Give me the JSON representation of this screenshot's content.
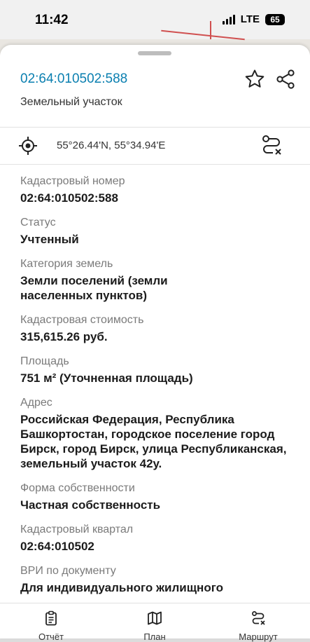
{
  "status_bar": {
    "time": "11:42",
    "network": "LTE",
    "battery": "65"
  },
  "header": {
    "cadastral_number": "02:64:010502:588",
    "object_type": "Земельный участок",
    "favorite_icon": "star-icon",
    "share_icon": "share-icon"
  },
  "location": {
    "coordinates": "55°26.44'N, 55°34.94'E",
    "locate_icon": "crosshair-icon",
    "route_icon": "route-icon"
  },
  "fields": [
    {
      "label": "Кадастровый номер",
      "value": "02:64:010502:588"
    },
    {
      "label": "Статус",
      "value": "Учтенный"
    },
    {
      "label": "Категория земель",
      "value": "Земли поселений (земли населенных пунктов)"
    },
    {
      "label": "Кадастровая стоимость",
      "value": "315,615.26 руб."
    },
    {
      "label": "Площадь",
      "value": "751 м² (Уточненная площадь)"
    },
    {
      "label": "Адрес",
      "value": "Российская Федерация, Республика Башкортостан, городское поселение город Бирск, город Бирск, улица Республиканская, земельный участок 42у."
    },
    {
      "label": "Форма собственности",
      "value": "Частная собственность"
    },
    {
      "label": "Кадастровый квартал",
      "value": "02:64:010502"
    },
    {
      "label": "ВРИ по документу",
      "value": "Для индивидуального жилищного"
    }
  ],
  "tabbar": {
    "report": "Отчёт",
    "plan": "План",
    "route": "Маршрут"
  },
  "colors": {
    "accent": "#0a7fb0",
    "label": "#7a7a7a"
  }
}
